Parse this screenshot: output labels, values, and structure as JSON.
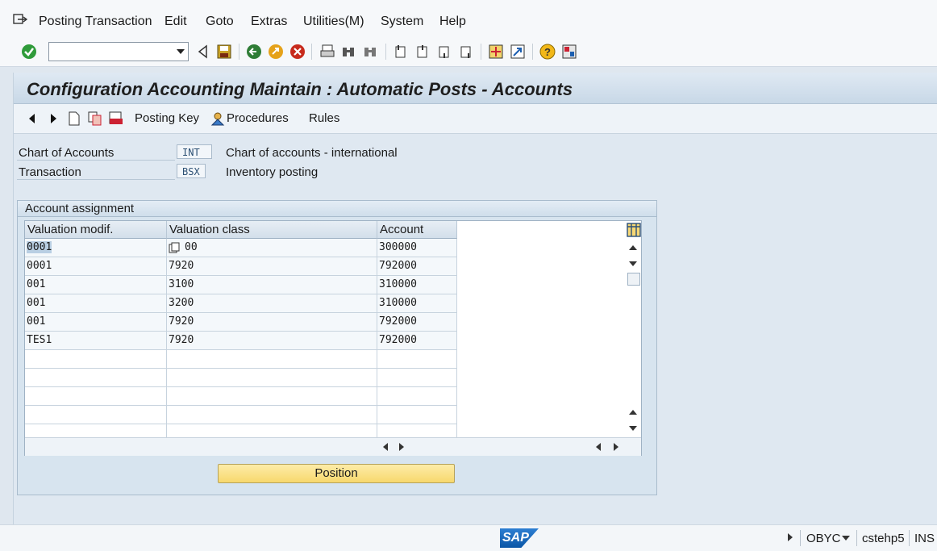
{
  "menubar": {
    "items": [
      {
        "label": "Posting Transaction",
        "u": "P"
      },
      {
        "label": "Edit",
        "u": "E"
      },
      {
        "label": "Goto",
        "u": "G"
      },
      {
        "label": "Extras",
        "u": "x"
      },
      {
        "label": "Utilities(M)",
        "u": "M"
      },
      {
        "label": "System",
        "u": "y"
      },
      {
        "label": "Help",
        "u": "H"
      }
    ]
  },
  "toolbar": {
    "command_field_value": ""
  },
  "title": "Configuration Accounting Maintain : Automatic Posts - Accounts",
  "app_toolbar": {
    "posting_key": "Posting Key",
    "procedures": "Procedures",
    "rules": "Rules"
  },
  "header": {
    "chart_label": "Chart of Accounts",
    "chart_code": "INT",
    "chart_desc": "Chart of accounts - international",
    "trans_label": "Transaction",
    "trans_code": "BSX",
    "trans_desc": "Inventory posting"
  },
  "assignment": {
    "title": "Account assignment",
    "columns": [
      "Valuation modif.",
      "Valuation class",
      "Account"
    ],
    "rows": [
      [
        "0001",
        "00",
        "300000"
      ],
      [
        "0001",
        "7920",
        "792000"
      ],
      [
        "001",
        "3100",
        "310000"
      ],
      [
        "001",
        "3200",
        "310000"
      ],
      [
        "001",
        "7920",
        "792000"
      ],
      [
        "TES1",
        "7920",
        "792000"
      ]
    ],
    "position_button": "Position"
  },
  "status": {
    "transaction": "OBYC",
    "server": "cstehp5",
    "mode": "INS"
  },
  "colors": {
    "accent": "#f7d86d",
    "background": "#dfe7ef"
  }
}
